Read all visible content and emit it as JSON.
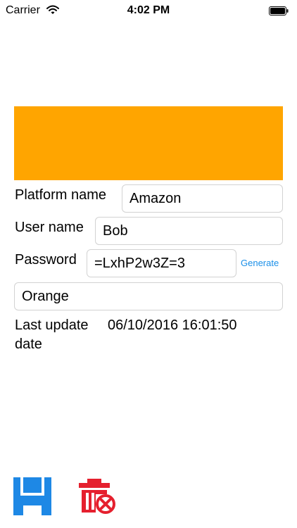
{
  "status_bar": {
    "carrier": "Carrier",
    "time": "4:02 PM",
    "wifi_icon": "wifi-icon",
    "battery_icon": "battery-icon"
  },
  "swatch": {
    "color": "#FFA500"
  },
  "form": {
    "platform_label": "Platform name",
    "platform_value": "Amazon",
    "user_label": "User name",
    "user_value": "Bob",
    "password_label": "Password",
    "password_value": "=LxhP2w3Z=3",
    "generate_label": "Generate",
    "color_value": "Orange",
    "last_update_label_line1": "Last update",
    "last_update_label_line2": "date",
    "last_update_value": "06/10/2016 16:01:50"
  },
  "toolbar": {
    "save_icon": "floppy-disk-icon",
    "save_color": "#1E88E5",
    "delete_icon": "trash-delete-icon",
    "delete_color": "#E5202E"
  }
}
